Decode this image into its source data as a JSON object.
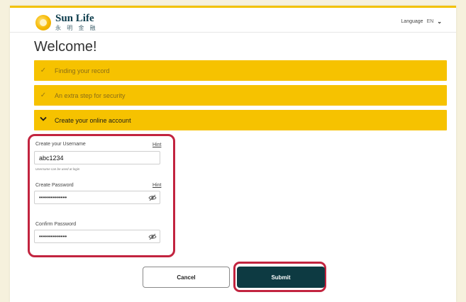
{
  "header": {
    "brand_name": "Sun Life",
    "brand_subtitle": "永 明 金 融",
    "language_label": "Language",
    "language_code": "EN"
  },
  "title": "Welcome!",
  "steps": [
    {
      "label": "Finding your record",
      "state": "done"
    },
    {
      "label": "An extra step for security",
      "state": "done"
    },
    {
      "label": "Create your online account",
      "state": "active"
    }
  ],
  "form": {
    "username_label": "Create your Username",
    "username_value": "abc1234",
    "username_hint": "Hint",
    "username_note": "Username can be used at login",
    "password_label": "Create Password",
    "password_value": "••••••••••••••",
    "password_hint": "Hint",
    "confirm_label": "Confirm Password",
    "confirm_value": "••••••••••••••"
  },
  "buttons": {
    "cancel": "Cancel",
    "submit": "Submit"
  },
  "colors": {
    "accent_yellow": "#f6c200",
    "highlight_red": "#c2243f",
    "submit_dark": "#0d3a42"
  }
}
